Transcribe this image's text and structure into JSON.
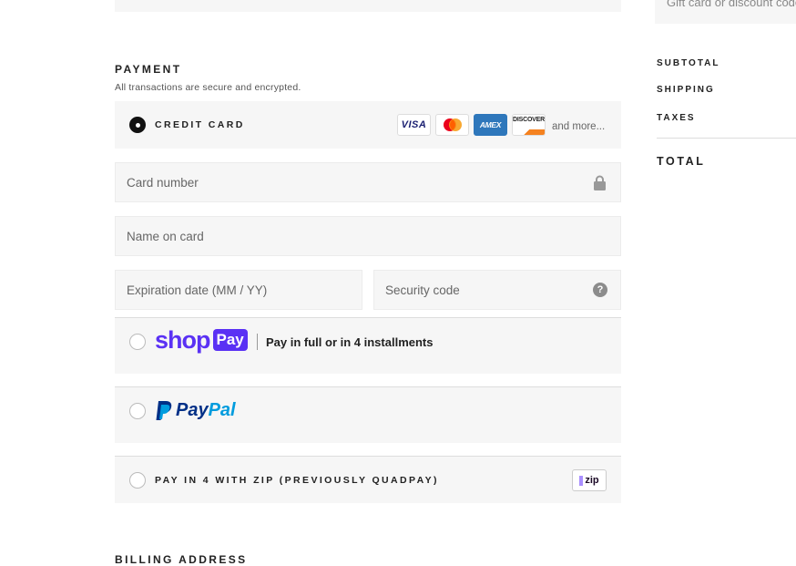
{
  "discount": {
    "placeholder": "Gift card or discount code"
  },
  "payment": {
    "title": "PAYMENT",
    "subtitle": "All transactions are secure and encrypted.",
    "credit_card": {
      "label": "CREDIT CARD",
      "brands": [
        "VISA",
        "MASTERCARD",
        "AMEX",
        "DISCOVER"
      ],
      "and_more": "and more..."
    },
    "fields": {
      "card_number": "Card number",
      "name_on_card": "Name on card",
      "expiration": "Expiration date (MM / YY)",
      "security_code": "Security code"
    },
    "shop_pay": {
      "logo_shop": "shop",
      "logo_pay": "Pay",
      "text": "Pay in full or in 4 installments"
    },
    "paypal": {
      "text_pay": "Pay",
      "text_pal": "Pal"
    },
    "zip": {
      "label": "PAY IN 4 WITH ZIP (PREVIOUSLY QUADPAY)",
      "badge": "zip"
    }
  },
  "summary": {
    "subtotal": "SUBTOTAL",
    "shipping": "SHIPPING",
    "taxes": "TAXES",
    "total": "TOTAL"
  },
  "billing": {
    "title": "BILLING ADDRESS"
  },
  "colors": {
    "shop_pay": "#5a31f4",
    "paypal_dark": "#003087",
    "paypal_light": "#009cde",
    "amex": "#2e77bb"
  }
}
